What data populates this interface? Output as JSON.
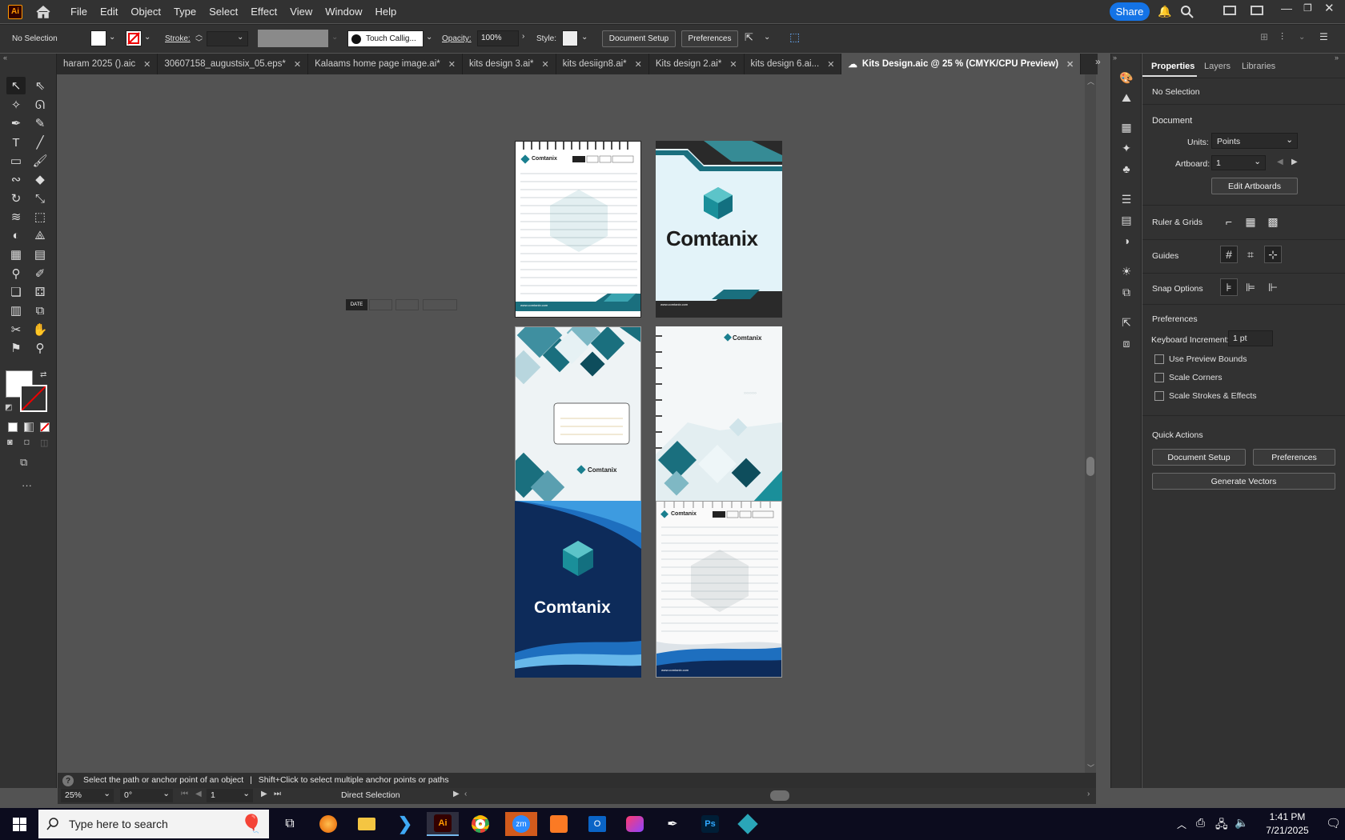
{
  "app": {
    "logo": "Ai"
  },
  "menu": [
    "File",
    "Edit",
    "Object",
    "Type",
    "Select",
    "Effect",
    "View",
    "Window",
    "Help"
  ],
  "share_label": "Share",
  "control": {
    "selection": "No Selection",
    "stroke_label": "Stroke:",
    "brush_name": "Touch Callig...",
    "opacity_label": "Opacity:",
    "opacity_value": "100%",
    "style_label": "Style:",
    "document_setup": "Document Setup",
    "preferences": "Preferences"
  },
  "tabs": [
    {
      "label": "haram 2025 ().aic",
      "active": false
    },
    {
      "label": "30607158_augustsix_05.eps*",
      "active": false
    },
    {
      "label": "Kalaams home page image.ai*",
      "active": false
    },
    {
      "label": "kits design 3.ai*",
      "active": false
    },
    {
      "label": "kits desiign8.ai*",
      "active": false
    },
    {
      "label": "Kits design 2.ai*",
      "active": false
    },
    {
      "label": "kits design 6.ai...",
      "active": false
    },
    {
      "label": "Kits Design.aic @ 25 % (CMYK/CPU Preview)",
      "active": true
    }
  ],
  "canvas": {
    "brand": "Comtanix",
    "website": "www.comtanix.com",
    "date_label": "DATE"
  },
  "properties": {
    "tabs": [
      "Properties",
      "Layers",
      "Libraries"
    ],
    "selection": "No Selection",
    "document_title": "Document",
    "units_label": "Units:",
    "units_value": "Points",
    "artboard_label": "Artboard:",
    "artboard_value": "1",
    "edit_artboards": "Edit Artboards",
    "rulers_grids": "Ruler & Grids",
    "guides": "Guides",
    "snap_options": "Snap Options",
    "preferences_title": "Preferences",
    "keyboard_increment_label": "Keyboard Increment:",
    "keyboard_increment_value": "1 pt",
    "use_preview_bounds": "Use Preview Bounds",
    "scale_corners": "Scale Corners",
    "scale_strokes": "Scale Strokes & Effects",
    "quick_actions": "Quick Actions",
    "qa_document_setup": "Document Setup",
    "qa_preferences": "Preferences",
    "qa_generate_vectors": "Generate Vectors"
  },
  "status": {
    "hint": "Select the path or anchor point of an object",
    "hint_extra": "Shift+Click to select multiple anchor points or paths",
    "zoom": "25%",
    "rotation": "0°",
    "artboard_nav": "1",
    "tool": "Direct Selection"
  },
  "taskbar": {
    "search_placeholder": "Type here to search",
    "time": "1:41 PM",
    "date": "7/21/2025"
  },
  "colors": {
    "accent": "#1473e6",
    "teal": "#1a7f8f",
    "navy": "#0d2b5a"
  }
}
